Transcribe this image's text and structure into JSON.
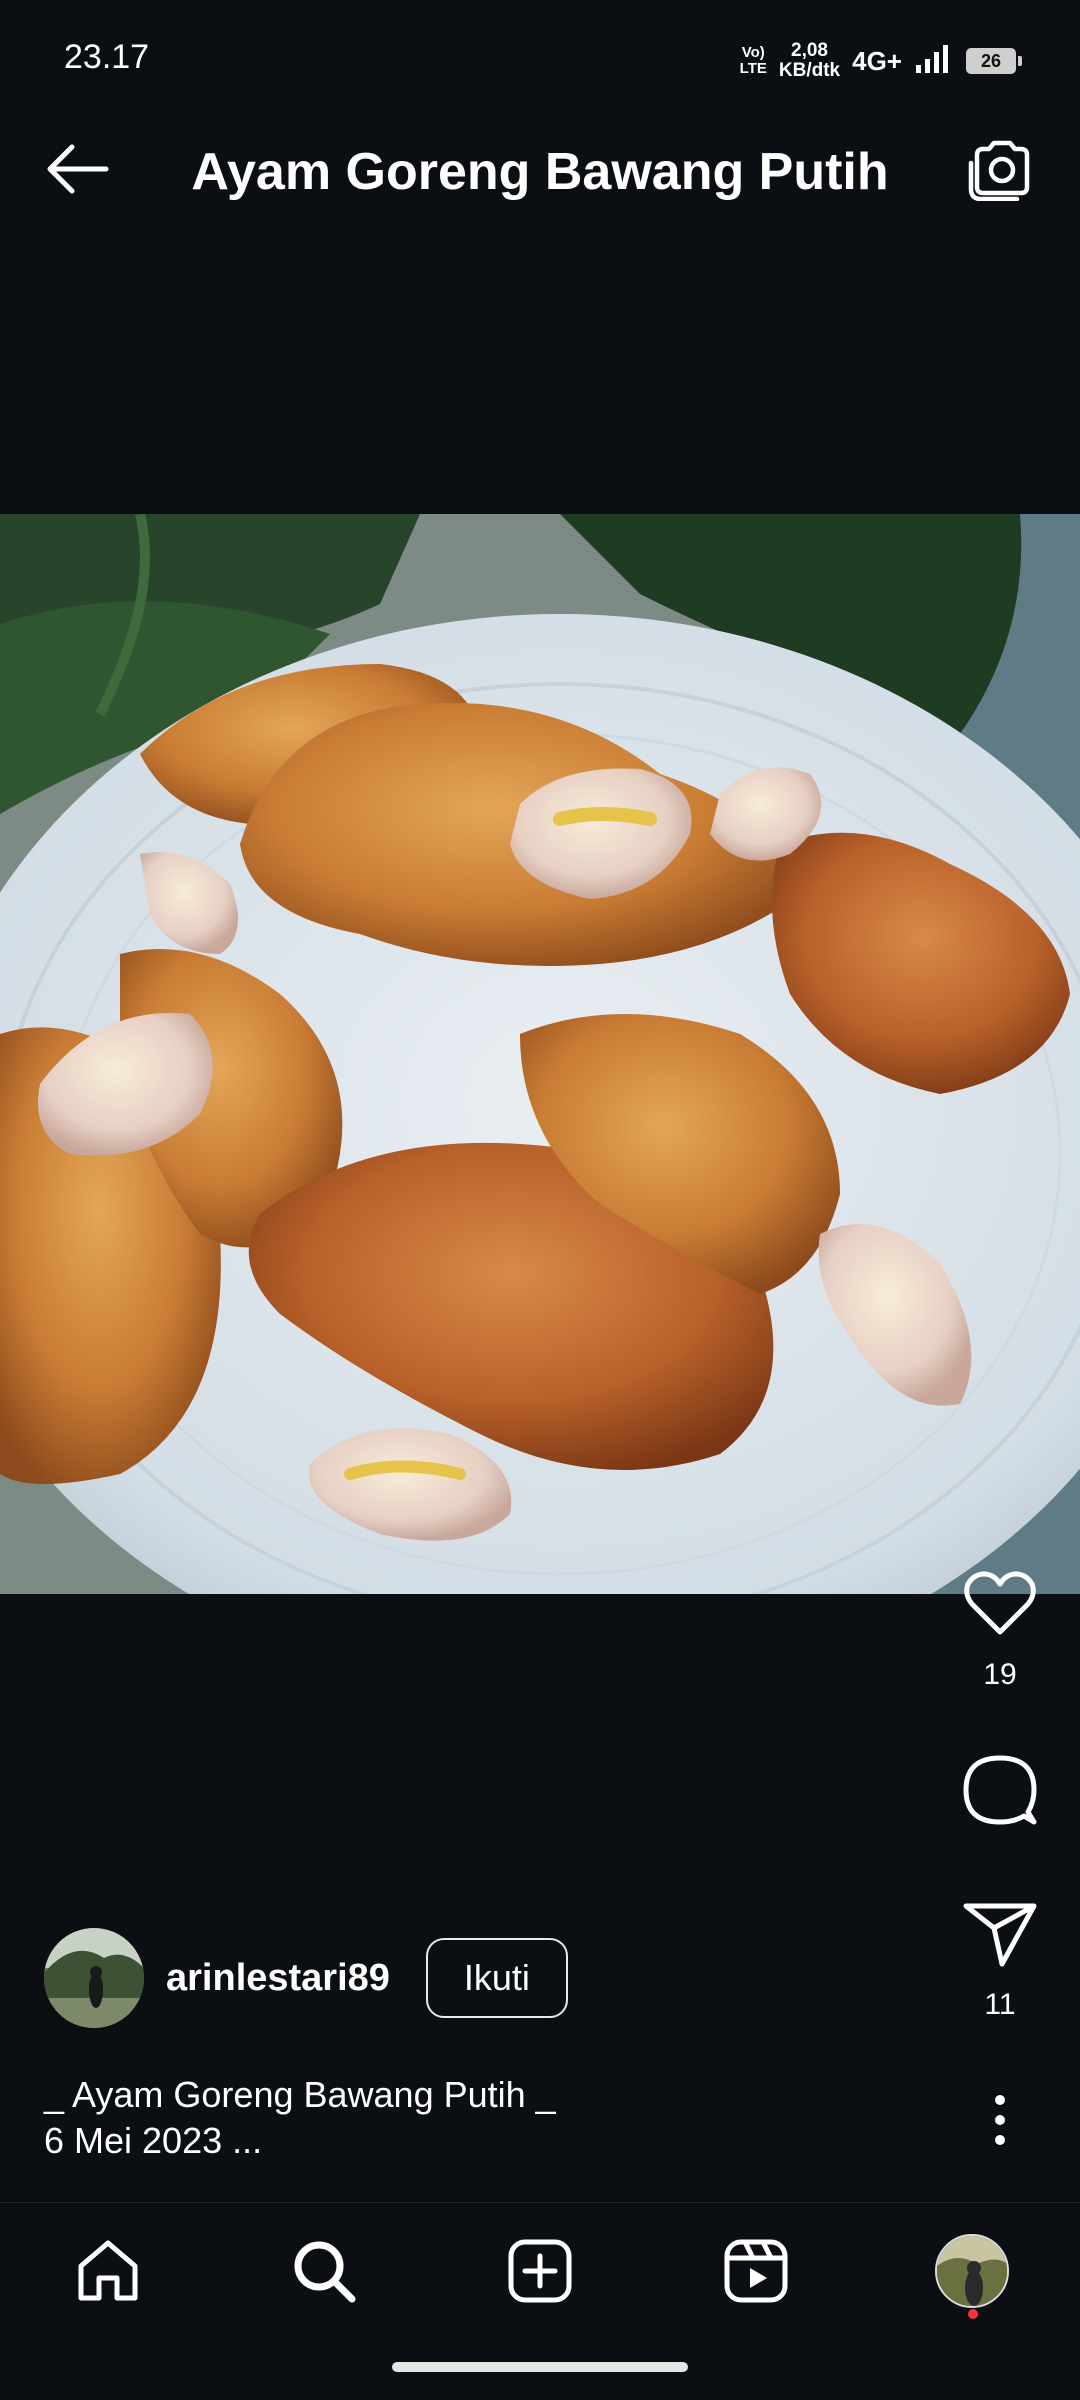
{
  "status_bar": {
    "time": "23.17",
    "volte_top": "Vo)",
    "volte_bottom": "LTE",
    "speed_value": "2,08",
    "speed_unit": "KB/dtk",
    "network": "4G+",
    "battery": "26"
  },
  "header": {
    "title": "Ayam Goreng Bawang Putih"
  },
  "post": {
    "like_count": "19",
    "share_count": "11",
    "author": "arinlestari89",
    "follow_label": "Ikuti",
    "caption_line1": "_ Ayam Goreng Bawang Putih _",
    "caption_line2": "6 Mei 2023 ..."
  },
  "icons": {
    "back": "arrow-left-icon",
    "camera": "camera-icon",
    "like": "heart-icon",
    "comment": "comment-icon",
    "share": "paper-plane-icon",
    "more": "more-vertical-icon",
    "home": "home-icon",
    "search": "search-icon",
    "create": "plus-square-icon",
    "reels": "reels-icon"
  },
  "colors": {
    "background": "#0b0f14",
    "text": "#ffffff",
    "notification": "#ff3040"
  }
}
